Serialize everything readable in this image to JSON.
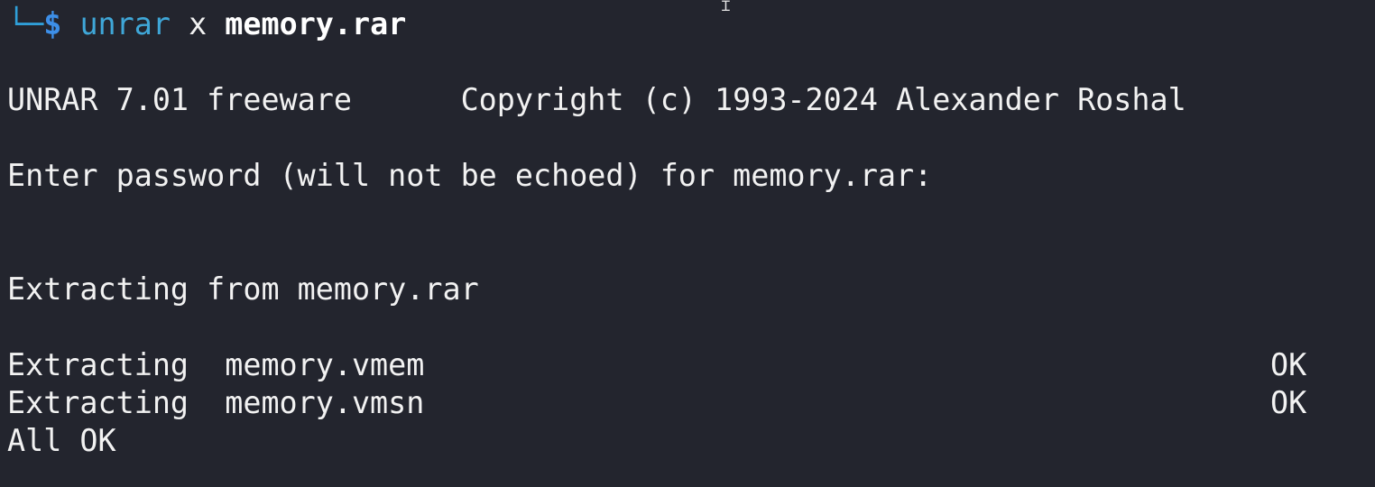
{
  "terminal": {
    "cut_prompt_fragment": "└─$ unrar x memory.rar",
    "prompt": {
      "corner": "└─",
      "symbol": "$",
      "command": "unrar",
      "subcommand": "x",
      "archive": "memory.rar"
    },
    "output": {
      "banner": "UNRAR 7.01 freeware      Copyright (c) 1993-2024 Alexander Roshal",
      "password_prompt": "Enter password (will not be echoed) for memory.rar:",
      "extracting_from": "Extracting from memory.rar",
      "files": [
        {
          "label": "Extracting  memory.vmem",
          "status": "OK"
        },
        {
          "label": "Extracting  memory.vmsn",
          "status": "OK"
        }
      ],
      "summary": "All OK"
    },
    "colors": {
      "background": "#23252e",
      "text": "#f2f2f2",
      "prompt_blue": "#2f9fd8",
      "command_cyan": "#3fa7d8"
    }
  }
}
